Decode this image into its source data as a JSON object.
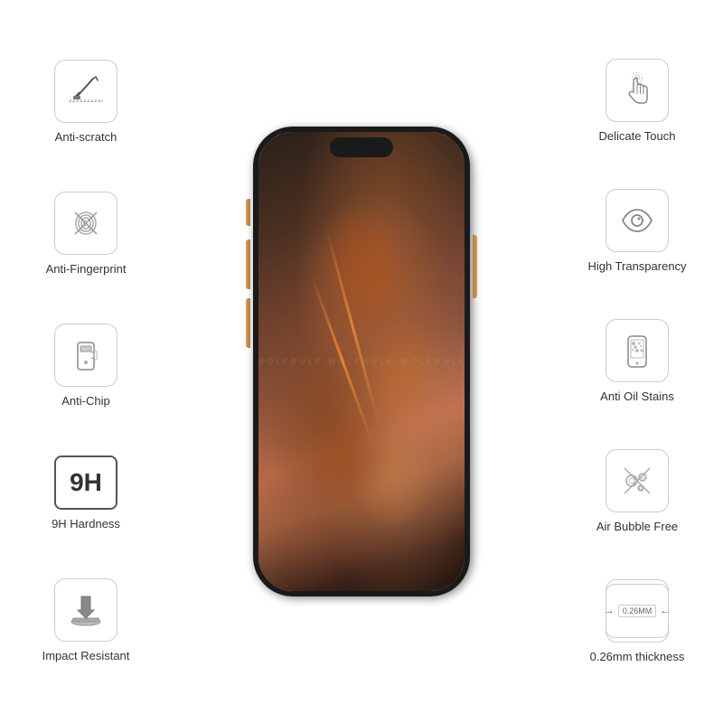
{
  "features": {
    "left": [
      {
        "id": "anti-scratch",
        "label": "Anti-scratch",
        "icon": "scratch"
      },
      {
        "id": "anti-fingerprint",
        "label": "Anti-Fingerprint",
        "icon": "fingerprint"
      },
      {
        "id": "anti-chip",
        "label": "Anti-Chip",
        "icon": "chip"
      },
      {
        "id": "9h-hardness",
        "label": "9H Hardness",
        "icon": "hardness"
      },
      {
        "id": "impact-resistant",
        "label": "Impact Resistant",
        "icon": "impact"
      }
    ],
    "right": [
      {
        "id": "delicate-touch",
        "label": "Delicate Touch",
        "icon": "touch"
      },
      {
        "id": "high-transparency",
        "label": "High Transparency",
        "icon": "eye"
      },
      {
        "id": "anti-oil-stains",
        "label": "Anti Oil Stains",
        "icon": "phone-dots"
      },
      {
        "id": "air-bubble-free",
        "label": "Air Bubble Free",
        "icon": "bubbles"
      },
      {
        "id": "thickness",
        "label": "0.26mm thickness",
        "icon": "thickness"
      }
    ]
  },
  "watermark": "WolfRule WolfRule WolfRule",
  "thickness_value": "0.26MM"
}
